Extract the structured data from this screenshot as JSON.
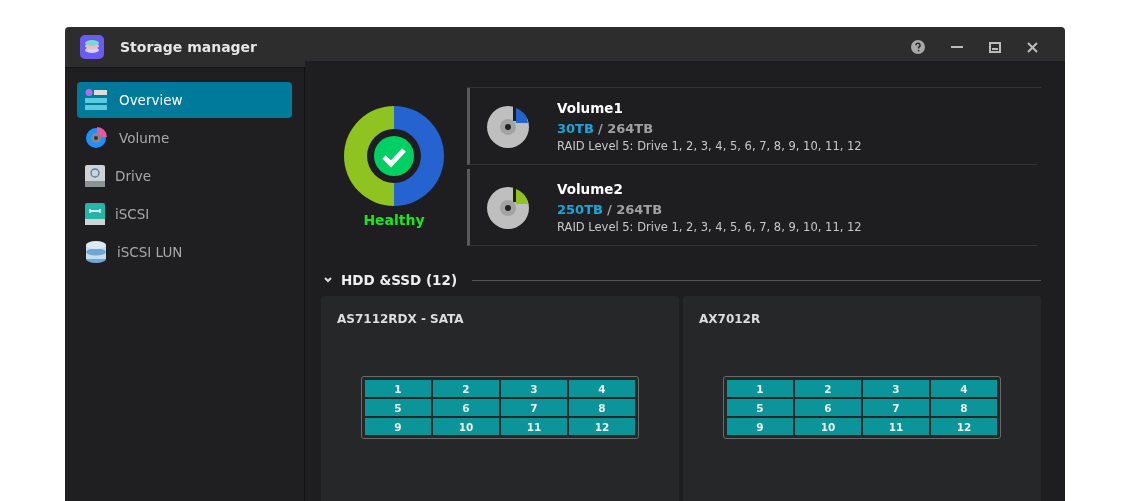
{
  "window": {
    "title": "Storage manager"
  },
  "sidebar": {
    "items": [
      {
        "label": "Overview",
        "kind": "overview",
        "selected": true
      },
      {
        "label": "Volume",
        "kind": "volume",
        "selected": false
      },
      {
        "label": "Drive",
        "kind": "drive",
        "selected": false
      },
      {
        "label": "iSCSI",
        "kind": "iscsi",
        "selected": false
      },
      {
        "label": "iSCSI LUN",
        "kind": "lun",
        "selected": false
      }
    ]
  },
  "health": {
    "status": "Healthy"
  },
  "volumes": [
    {
      "name": "Volume1",
      "used": "30TB",
      "total": "/ 264TB",
      "raid": "RAID Level 5: Drive 1, 2, 3, 4, 5, 6, 7, 8, 9, 10, 11, 12",
      "color": "#2563d0"
    },
    {
      "name": "Volume2",
      "used": "250TB",
      "total": "/ 264TB",
      "raid": "RAID Level 5: Drive 1, 2, 3, 4, 5, 6, 7, 8, 9, 10, 11, 12",
      "color": "#8fc31f"
    }
  ],
  "drives_section": {
    "title": "HDD &SSD (12)",
    "expanded": true,
    "enclosures": [
      {
        "name": "AS7112RDX - SATA",
        "bays": [
          "1",
          "2",
          "3",
          "4",
          "5",
          "6",
          "7",
          "8",
          "9",
          "10",
          "11",
          "12"
        ]
      },
      {
        "name": "AX7012R",
        "bays": [
          "1",
          "2",
          "3",
          "4",
          "5",
          "6",
          "7",
          "8",
          "9",
          "10",
          "11",
          "12"
        ]
      }
    ]
  }
}
